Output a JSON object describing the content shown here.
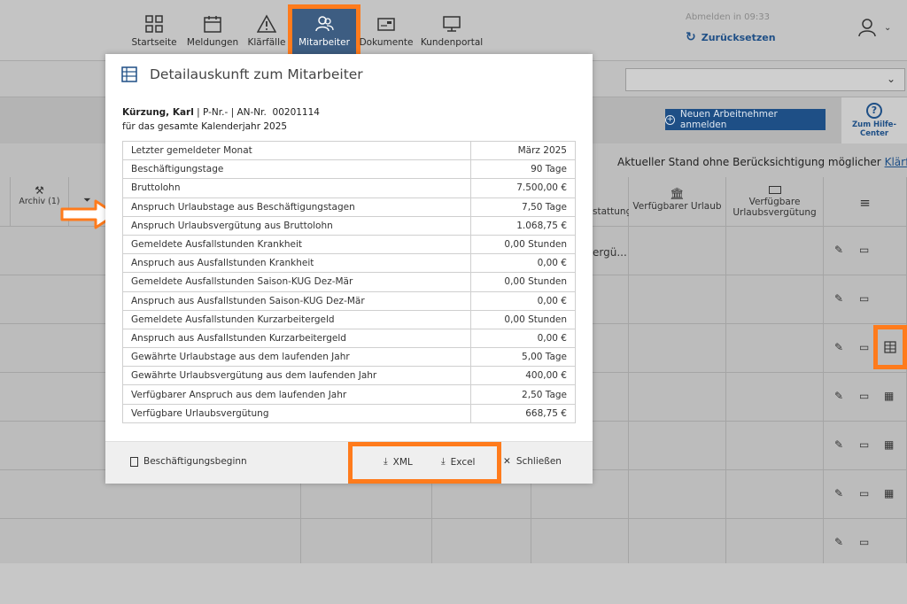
{
  "nav": {
    "items": [
      {
        "label": "Startseite",
        "icon": "grid-icon"
      },
      {
        "label": "Meldungen",
        "icon": "calendar-icon"
      },
      {
        "label": "Klärfälle",
        "icon": "warning-icon"
      },
      {
        "label": "Mitarbeiter",
        "icon": "people-icon",
        "active": true
      },
      {
        "label": "Dokumente",
        "icon": "envelope-icon"
      },
      {
        "label": "Kundenportal",
        "icon": "monitor-icon"
      }
    ]
  },
  "session": {
    "logout_text": "Abmelden in 09:33",
    "reset_label": "Zurücksetzen"
  },
  "toolbar": {
    "new_employee_label": "Neuen Arbeitnehmer anmelden",
    "help_label": "Zum Hilfe-Center"
  },
  "status_line": {
    "text": "Aktueller Stand ohne Berücksichtigung möglicher",
    "link": "Klärfälle"
  },
  "grid": {
    "headers": {
      "col_archiv": "Archiv (1)",
      "col_erstattung": "stattung",
      "col_urlaub": "Verfügbarer Urlaub",
      "col_verguetung": "Verfügbare Urlaubsvergütung"
    },
    "first_row_partial": "ergü..."
  },
  "modal": {
    "title": "Detailauskunft zum Mitarbeiter",
    "employee_name": "Kürzung, Karl",
    "ids": " | P-Nr.- | AN-Nr.  00201114",
    "period": "für das gesamte Kalenderjahr 2025",
    "rows": [
      {
        "label": "Letzter gemeldeter Monat",
        "value": "März 2025"
      },
      {
        "label": "Beschäftigungstage",
        "value": "90 Tage"
      },
      {
        "label": "Bruttolohn",
        "value": "7.500,00 €"
      },
      {
        "label": "Anspruch Urlaubstage aus Beschäftigungstagen",
        "value": "7,50 Tage"
      },
      {
        "label": "Anspruch Urlaubsvergütung aus Bruttolohn",
        "value": "1.068,75 €"
      },
      {
        "label": "Gemeldete Ausfallstunden Krankheit",
        "value": "0,00 Stunden"
      },
      {
        "label": "Anspruch aus Ausfallstunden Krankheit",
        "value": "0,00 €"
      },
      {
        "label": "Gemeldete Ausfallstunden Saison-KUG Dez-Mär",
        "value": "0,00 Stunden"
      },
      {
        "label": "Anspruch aus Ausfallstunden Saison-KUG Dez-Mär",
        "value": "0,00 €"
      },
      {
        "label": "Gemeldete Ausfallstunden Kurzarbeitergeld",
        "value": "0,00 Stunden"
      },
      {
        "label": "Anspruch aus Ausfallstunden Kurzarbeitergeld",
        "value": "0,00 €"
      },
      {
        "label": "Gewährte Urlaubstage aus dem laufenden Jahr",
        "value": "5,00 Tage"
      },
      {
        "label": "Gewährte Urlaubsvergütung aus dem laufenden Jahr",
        "value": "400,00 €"
      },
      {
        "label": "Verfügbarer Anspruch aus dem laufenden Jahr",
        "value": "2,50 Tage"
      },
      {
        "label": "Verfügbare Urlaubsvergütung",
        "value": "668,75 €"
      }
    ],
    "footer": {
      "start_label": "Beschäftigungsbeginn",
      "xml_label": "XML",
      "excel_label": "Excel",
      "close_label": "Schließen"
    }
  },
  "colors": {
    "accent": "#ff7b1c",
    "primary": "#1e4f86",
    "nav_active": "#3d5d82"
  }
}
